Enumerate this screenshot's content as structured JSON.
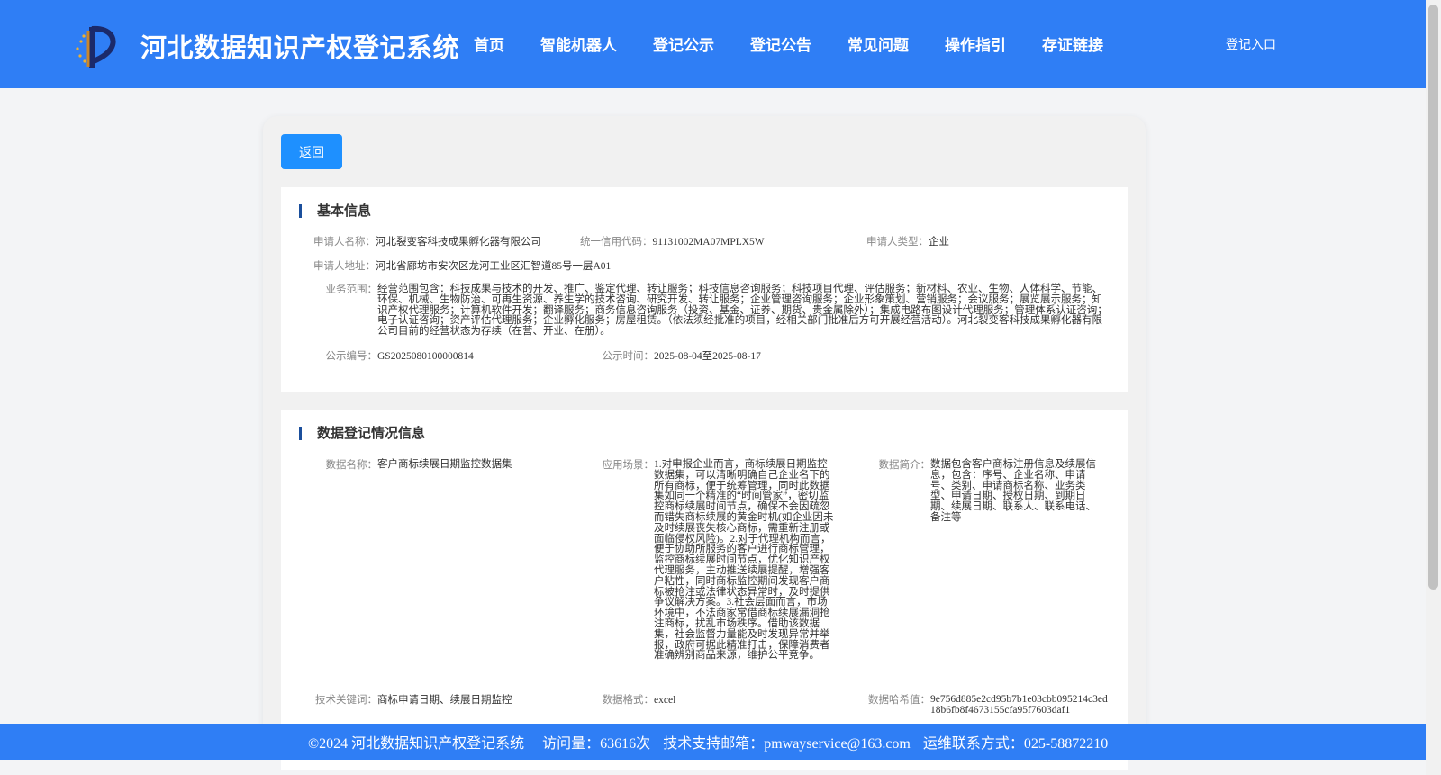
{
  "header": {
    "title": "河北数据知识产权登记系统",
    "nav": [
      "首页",
      "智能机器人",
      "登记公示",
      "登记公告",
      "常见问题",
      "操作指引",
      "存证链接"
    ],
    "login": "登记入口"
  },
  "back_label": "返回",
  "basic": {
    "title": "基本信息",
    "applicant_name": {
      "label": "申请人名称：",
      "value": "河北裂变客科技成果孵化器有限公司"
    },
    "credit_code": {
      "label": "统一信用代码：",
      "value": "91131002MA07MPLX5W"
    },
    "applicant_type": {
      "label": "申请人类型：",
      "value": "企业"
    },
    "address": {
      "label": "申请人地址：",
      "value": "河北省廊坊市安次区龙河工业区汇智道85号一层A01"
    },
    "scope": {
      "label": "业务范围：",
      "value": "经营范围包含：科技成果与技术的开发、推广、鉴定代理、转让服务；科技信息咨询服务；科技项目代理、评估服务；新材料、农业、生物、人体科学、节能、环保、机械、生物防治、可再生资源、养生学的技术咨询、研究开发、转让服务；企业管理咨询服务；企业形象策划、营销服务；会议服务；展览展示服务；知识产权代理服务；计算机软件开发；翻译服务；商务信息咨询服务（投资、基金、证券、期货、贵金属除外）；集成电路布图设计代理服务；管理体系认证咨询；电子认证咨询；资产评估代理服务；企业孵化服务；房屋租赁。（依法须经批准的项目，经相关部门批准后方可开展经营活动）。河北裂变客科技成果孵化器有限公司目前的经营状态为存续（在营、开业、在册）。"
    },
    "notice_no": {
      "label": "公示编号：",
      "value": "GS2025080100000814"
    },
    "notice_time": {
      "label": "公示时间：",
      "value": "2025-08-04至2025-08-17"
    }
  },
  "data_reg": {
    "title": "数据登记情况信息",
    "data_name": {
      "label": "数据名称：",
      "value": "客户商标续展日期监控数据集"
    },
    "scenario": {
      "label": "应用场景：",
      "value": "1.对申报企业而言，商标续展日期监控数据集，可以清晰明确自己企业名下的所有商标，便于统筹管理，同时此数据集如同一个精准的“时间管家”，密切监控商标续展时间节点，确保不会因疏忽而错失商标续展的黄金时机(如企业因未及时续展丧失核心商标，需重新注册或面临侵权风险)。2.对于代理机构而言，便于协助所服务的客户进行商标管理，监控商标续展时间节点，优化知识产权代理服务，主动推送续展提醒，增强客户粘性，同时商标监控期间发现客户商标被抢注或法律状态异常时，及时提供争议解决方案。3.社会层面而言，市场环境中，不法商家常借商标续展漏洞抢注商标，扰乱市场秩序。借助该数据集，社会监督力量能及时发现异常并举报，政府可据此精准打击，保障消费者准确辨别商品来源，维护公平竞争。"
    },
    "summary": {
      "label": "数据简介：",
      "value": "数据包含客户商标注册信息及续展信息，包含：序号、企业名称、申请号、类别、申请商标名称、业务类型、申请日期、授权日期、到期日期、续展日期、联系人、联系电话、备注等"
    },
    "keywords": {
      "label": "技术关键词：",
      "value": "商标申请日期、续展日期监控"
    },
    "format": {
      "label": "数据格式：",
      "value": "excel"
    },
    "hash": {
      "label": "数据哈希值：",
      "value": "9e756d885e2cd95b7b1e03cbb095214c3ed18b6fb8f4673155cfa95f7603daf1"
    }
  },
  "footer": {
    "copyright": "©2024 河北数据知识产权登记系统",
    "visits": "访问量：63616次",
    "email": "技术支持邮箱：pmwayservice@163.com",
    "phone": "运维联系方式：025-58872210"
  }
}
